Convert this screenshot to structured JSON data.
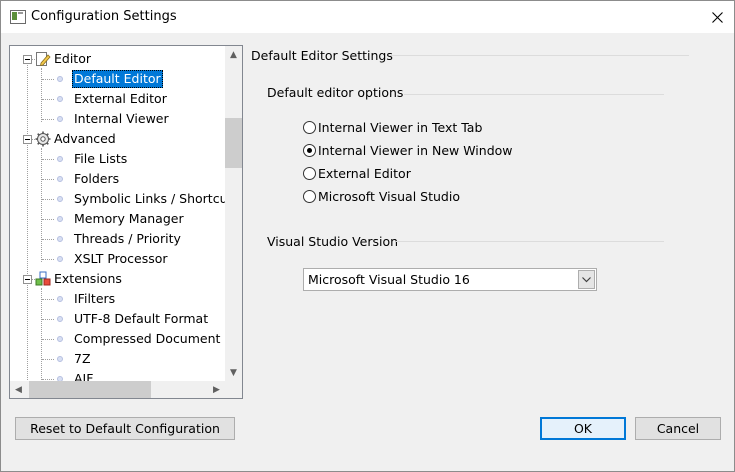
{
  "window": {
    "title": "Configuration Settings"
  },
  "tree": {
    "items": [
      {
        "label": "Editor",
        "type": "group",
        "icon": "pencil-page-icon"
      },
      {
        "label": "Default Editor",
        "type": "child",
        "selected": true
      },
      {
        "label": "External Editor",
        "type": "child"
      },
      {
        "label": "Internal Viewer",
        "type": "child"
      },
      {
        "label": "Advanced",
        "type": "group",
        "icon": "gear-icon"
      },
      {
        "label": "File Lists",
        "type": "child"
      },
      {
        "label": "Folders",
        "type": "child"
      },
      {
        "label": "Symbolic Links / Shortcut",
        "type": "child"
      },
      {
        "label": "Memory Manager",
        "type": "child"
      },
      {
        "label": "Threads / Priority",
        "type": "child"
      },
      {
        "label": "XSLT Processor",
        "type": "child"
      },
      {
        "label": "Extensions",
        "type": "group",
        "icon": "blocks-icon"
      },
      {
        "label": "IFilters",
        "type": "child"
      },
      {
        "label": "UTF-8 Default Format",
        "type": "child"
      },
      {
        "label": "Compressed Document R",
        "type": "child"
      },
      {
        "label": "7Z",
        "type": "child"
      },
      {
        "label": "AIF",
        "type": "child"
      }
    ]
  },
  "panel": {
    "title": "Default Editor Settings",
    "options_group": "Default editor options",
    "options": [
      {
        "label": "Internal Viewer in Text Tab",
        "checked": false
      },
      {
        "label": "Internal Viewer in New Window",
        "checked": true
      },
      {
        "label": "External Editor",
        "checked": false
      },
      {
        "label": "Microsoft Visual Studio",
        "checked": false
      }
    ],
    "vs_group": "Visual Studio Version",
    "vs_selected": "Microsoft Visual Studio 16"
  },
  "buttons": {
    "reset": "Reset to Default Configuration",
    "ok": "OK",
    "cancel": "Cancel"
  }
}
